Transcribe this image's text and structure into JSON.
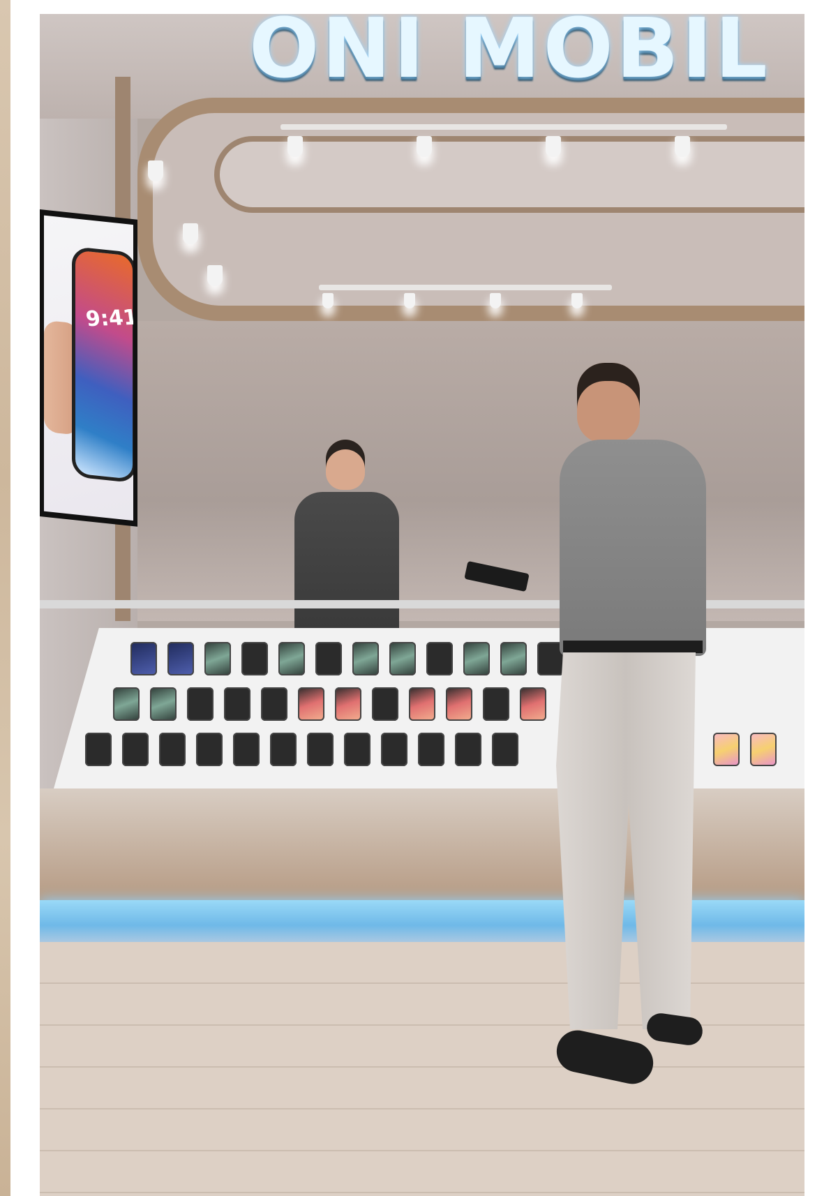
{
  "image": {
    "brand_sign": "ONI MOBIL",
    "ad_screen_time": "9:41"
  },
  "colors": {
    "sign_glow": "#e6f7ff",
    "wood_trim": "#a88c72",
    "led_strip": "#8fd3ff",
    "floor": "#ddd0c5"
  }
}
